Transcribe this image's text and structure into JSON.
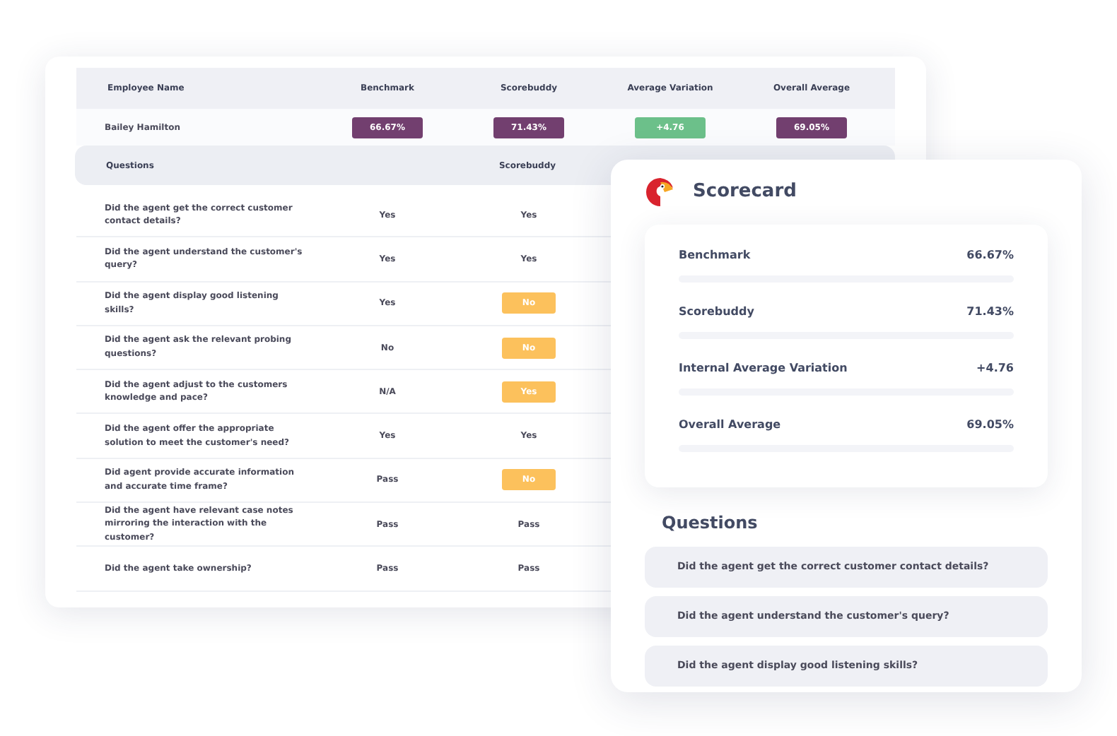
{
  "table": {
    "columns": [
      "Employee Name",
      "Benchmark",
      "Scorebuddy",
      "Average Variation",
      "Overall Average"
    ],
    "employee": {
      "name": "Bailey Hamilton",
      "values": [
        {
          "text": "66.67%",
          "color": "#723f6f"
        },
        {
          "text": "71.43%",
          "color": "#723f6f"
        },
        {
          "text": "+4.76",
          "color": "#6cc08a"
        },
        {
          "text": "69.05%",
          "color": "#723f6f"
        }
      ]
    },
    "question_columns": [
      "Questions",
      "Scorebuddy"
    ],
    "rows": [
      {
        "question": "Did the agent get the correct customer contact details?",
        "benchmark": "Yes",
        "scorebuddy": {
          "text": "Yes",
          "kind": "plain"
        }
      },
      {
        "question": "Did the agent understand the customer's query?",
        "benchmark": "Yes",
        "scorebuddy": {
          "text": "Yes",
          "kind": "plain"
        }
      },
      {
        "question": "Did the agent display good listening skills?",
        "benchmark": "Yes",
        "scorebuddy": {
          "text": "No",
          "kind": "badge"
        }
      },
      {
        "question": "Did the agent ask the relevant probing questions?",
        "benchmark": "No",
        "scorebuddy": {
          "text": "No",
          "kind": "badge"
        }
      },
      {
        "question": "Did the agent adjust to the customers knowledge and pace?",
        "benchmark": "N/A",
        "scorebuddy": {
          "text": "Yes",
          "kind": "badge"
        }
      },
      {
        "question": "Did the agent offer the appropriate solution to meet the customer's need?",
        "benchmark": "Yes",
        "scorebuddy": {
          "text": "Yes",
          "kind": "plain"
        }
      },
      {
        "question": "Did agent provide accurate information and accurate time frame?",
        "benchmark": "Pass",
        "scorebuddy": {
          "text": "No",
          "kind": "badge"
        }
      },
      {
        "question": "Did the agent have relevant case notes mirroring the interaction with the customer?",
        "benchmark": "Pass",
        "scorebuddy": {
          "text": "Pass",
          "kind": "plain"
        }
      },
      {
        "question": "Did the agent take ownership?",
        "benchmark": "Pass",
        "scorebuddy": {
          "text": "Pass",
          "kind": "plain"
        }
      }
    ]
  },
  "scorecard": {
    "title": "Scorecard",
    "metrics": [
      {
        "label": "Benchmark",
        "value": "66.67%"
      },
      {
        "label": "Scorebuddy",
        "value": "71.43%"
      },
      {
        "label": "Internal Average Variation",
        "value": "+4.76"
      },
      {
        "label": "Overall Average",
        "value": "69.05%"
      }
    ],
    "questions_title": "Questions",
    "questions": [
      "Did the agent get the correct customer contact details?",
      "Did the agent understand the customer's query?",
      "Did the agent display good listening skills?"
    ]
  }
}
